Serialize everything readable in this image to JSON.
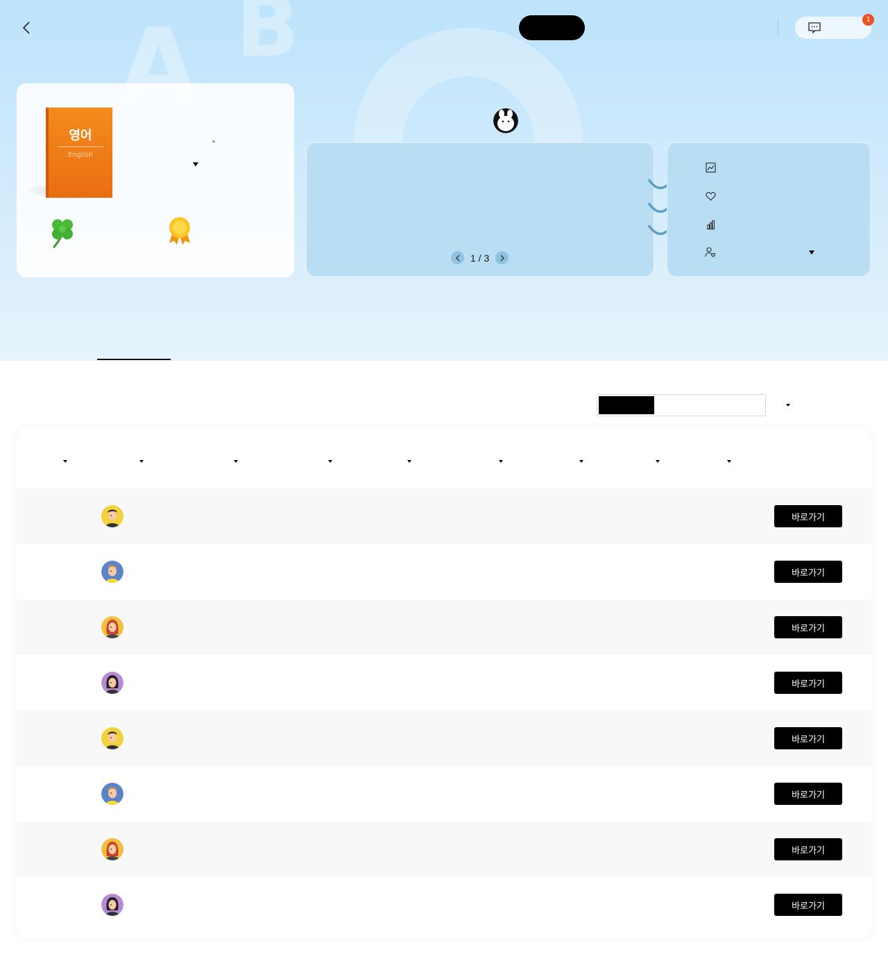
{
  "header": {
    "notification_count": "1",
    "accent_color": "#f04e23"
  },
  "subject_card": {
    "book_title": "영어",
    "book_subtitle": "English",
    "book_color": "#f08019"
  },
  "lesson_card": {
    "pager_text": "1 / 3"
  },
  "side_menu": {
    "icons": [
      "chart-image-icon",
      "heart-icon",
      "bar-chart-icon",
      "user-heart-icon"
    ]
  },
  "table": {
    "header_sort_icons": 9,
    "rows": [
      {
        "avatar": "avatar-yellow-boy",
        "go_label": "바로가기"
      },
      {
        "avatar": "avatar-blue-boy",
        "go_label": "바로가기"
      },
      {
        "avatar": "avatar-red-girl",
        "go_label": "바로가기"
      },
      {
        "avatar": "avatar-purple-girl",
        "go_label": "바로가기"
      },
      {
        "avatar": "avatar-yellow-boy",
        "go_label": "바로가기"
      },
      {
        "avatar": "avatar-blue-boy",
        "go_label": "바로가기"
      },
      {
        "avatar": "avatar-red-girl",
        "go_label": "바로가기"
      },
      {
        "avatar": "avatar-purple-girl",
        "go_label": "바로가기"
      }
    ]
  }
}
